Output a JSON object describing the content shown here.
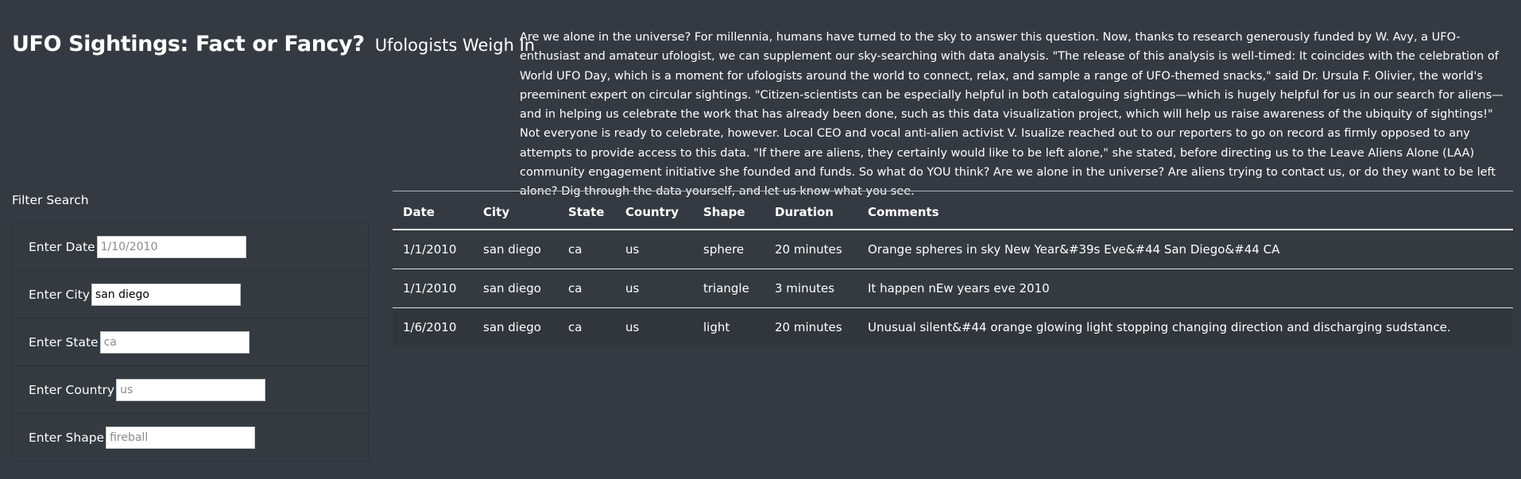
{
  "header": {
    "title": "UFO Sightings: Fact or Fancy?",
    "subtitle": "Ufologists Weigh In"
  },
  "intro": {
    "text": "Are we alone in the universe? For millennia, humans have turned to the sky to answer this question. Now, thanks to research generously funded by W. Avy, a UFO-enthusiast and amateur ufologist, we can supplement our sky-searching with data analysis. \"The release of this analysis is well-timed: It coincides with the celebration of World UFO Day, which is a moment for ufologists around the world to connect, relax, and sample a range of UFO-themed snacks,\" said Dr. Ursula F. Olivier, the world's preeminent expert on circular sightings. \"Citizen-scientists can be especially helpful in both cataloguing sightings—which is hugely helpful for us in our search for aliens—and in helping us celebrate the work that has already been done, such as this data visualization project, which will help us raise awareness of the ubiquity of sightings!\" Not everyone is ready to celebrate, however. Local CEO and vocal anti-alien activist V. Isualize reached out to our reporters to go on record as firmly opposed to any attempts to provide access to this data. \"If there are aliens, they certainly would like to be left alone,\" she stated, before directing us to the Leave Aliens Alone (LAA) community engagement initiative she founded and funds. So what do YOU think? Are we alone in the universe? Are aliens trying to contact us, or do they want to be left alone? Dig through the data yourself, and let us know what you see."
  },
  "filters": {
    "title": "Filter Search",
    "date": {
      "label": "Enter Date",
      "placeholder": "1/10/2010",
      "value": ""
    },
    "city": {
      "label": "Enter City",
      "placeholder": "",
      "value": "san diego"
    },
    "state": {
      "label": "Enter State",
      "placeholder": "ca",
      "value": ""
    },
    "country": {
      "label": "Enter Country",
      "placeholder": "us",
      "value": ""
    },
    "shape": {
      "label": "Enter Shape",
      "placeholder": "fireball",
      "value": ""
    }
  },
  "table": {
    "headers": {
      "date": "Date",
      "city": "City",
      "state": "State",
      "country": "Country",
      "shape": "Shape",
      "duration": "Duration",
      "comments": "Comments"
    },
    "rows": [
      {
        "date": "1/1/2010",
        "city": "san diego",
        "state": "ca",
        "country": "us",
        "shape": "sphere",
        "duration": "20 minutes",
        "comments": "Orange spheres in sky New Year&#39s Eve&#44 San Diego&#44 CA"
      },
      {
        "date": "1/1/2010",
        "city": "san diego",
        "state": "ca",
        "country": "us",
        "shape": "triangle",
        "duration": "3 minutes",
        "comments": "It happen nEw years eve 2010"
      },
      {
        "date": "1/6/2010",
        "city": "san diego",
        "state": "ca",
        "country": "us",
        "shape": "light",
        "duration": "20 minutes",
        "comments": "Unusual silent&#44 orange glowing light stopping changing direction and discharging sudstance."
      }
    ]
  }
}
